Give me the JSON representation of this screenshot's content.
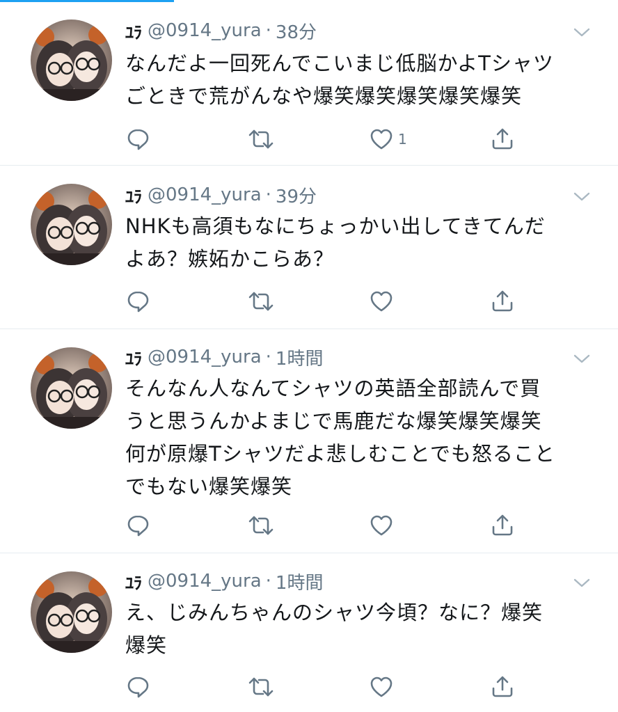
{
  "tweets": [
    {
      "name": "ﾕﾗ",
      "handle": "@0914_yura",
      "separator": "·",
      "time": "38分",
      "lines": [
        "なんだよ一回死んでこいまじ低脳かよTシャツ",
        "ごときで荒がんなや爆笑爆笑爆笑爆笑爆笑"
      ],
      "reply_count": "",
      "retweet_count": "",
      "like_count": "1"
    },
    {
      "name": "ﾕﾗ",
      "handle": "@0914_yura",
      "separator": "·",
      "time": "39分",
      "lines": [
        "NHKも高須もなにちょっかい出してきてんだ",
        "よあ？嫉妬かこらあ？"
      ],
      "reply_count": "",
      "retweet_count": "",
      "like_count": ""
    },
    {
      "name": "ﾕﾗ",
      "handle": "@0914_yura",
      "separator": "·",
      "time": "1時間",
      "lines": [
        "そんなん人なんてシャツの英語全部読んで買",
        "うと思うんかよまじで馬鹿だな爆笑爆笑爆笑",
        "何が原爆Tシャツだよ悲しむことでも怒ること",
        "でもない爆笑爆笑"
      ],
      "reply_count": "",
      "retweet_count": "",
      "like_count": ""
    },
    {
      "name": "ﾕﾗ",
      "handle": "@0914_yura",
      "separator": "·",
      "time": "1時間",
      "lines": [
        "え、じみんちゃんのシャツ今頃？なに？爆笑",
        "爆笑"
      ],
      "reply_count": "",
      "retweet_count": "",
      "like_count": ""
    }
  ],
  "icons": {
    "reply": "reply-icon",
    "retweet": "retweet-icon",
    "like": "heart-icon",
    "share": "share-icon",
    "caret": "chevron-down-icon"
  },
  "colors": {
    "text": "#14171a",
    "secondary": "#657786",
    "divider": "#e6ecf0",
    "accent": "#1da1f2"
  }
}
